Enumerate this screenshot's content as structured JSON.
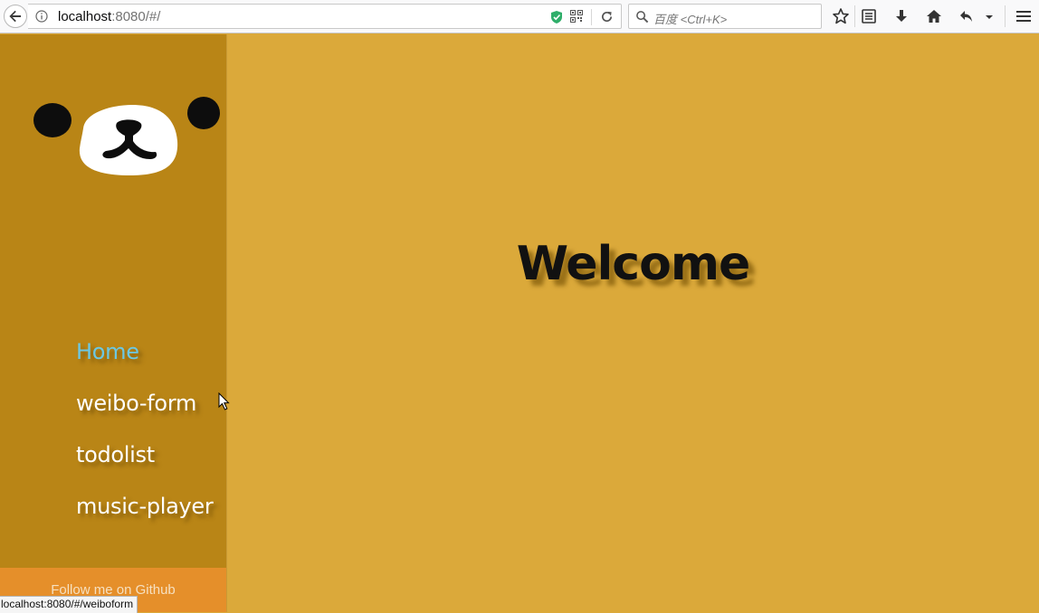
{
  "browser": {
    "url_host": "localhost",
    "url_rest": ":8080/#/",
    "search_placeholder": "百度 <Ctrl+K>",
    "status_url": "localhost:8080/#/weiboform"
  },
  "sidebar": {
    "nav": [
      {
        "label": "Home",
        "active": true
      },
      {
        "label": "weibo-form",
        "active": false
      },
      {
        "label": "todolist",
        "active": false
      },
      {
        "label": "music-player",
        "active": false
      }
    ],
    "github_label": "Follow me on Github"
  },
  "main": {
    "heading": "Welcome"
  },
  "colors": {
    "page_bg": "#dba93a",
    "sidebar_bg": "#b98516",
    "github_bg": "#e58f2a",
    "active_link": "#6cc8e2"
  }
}
